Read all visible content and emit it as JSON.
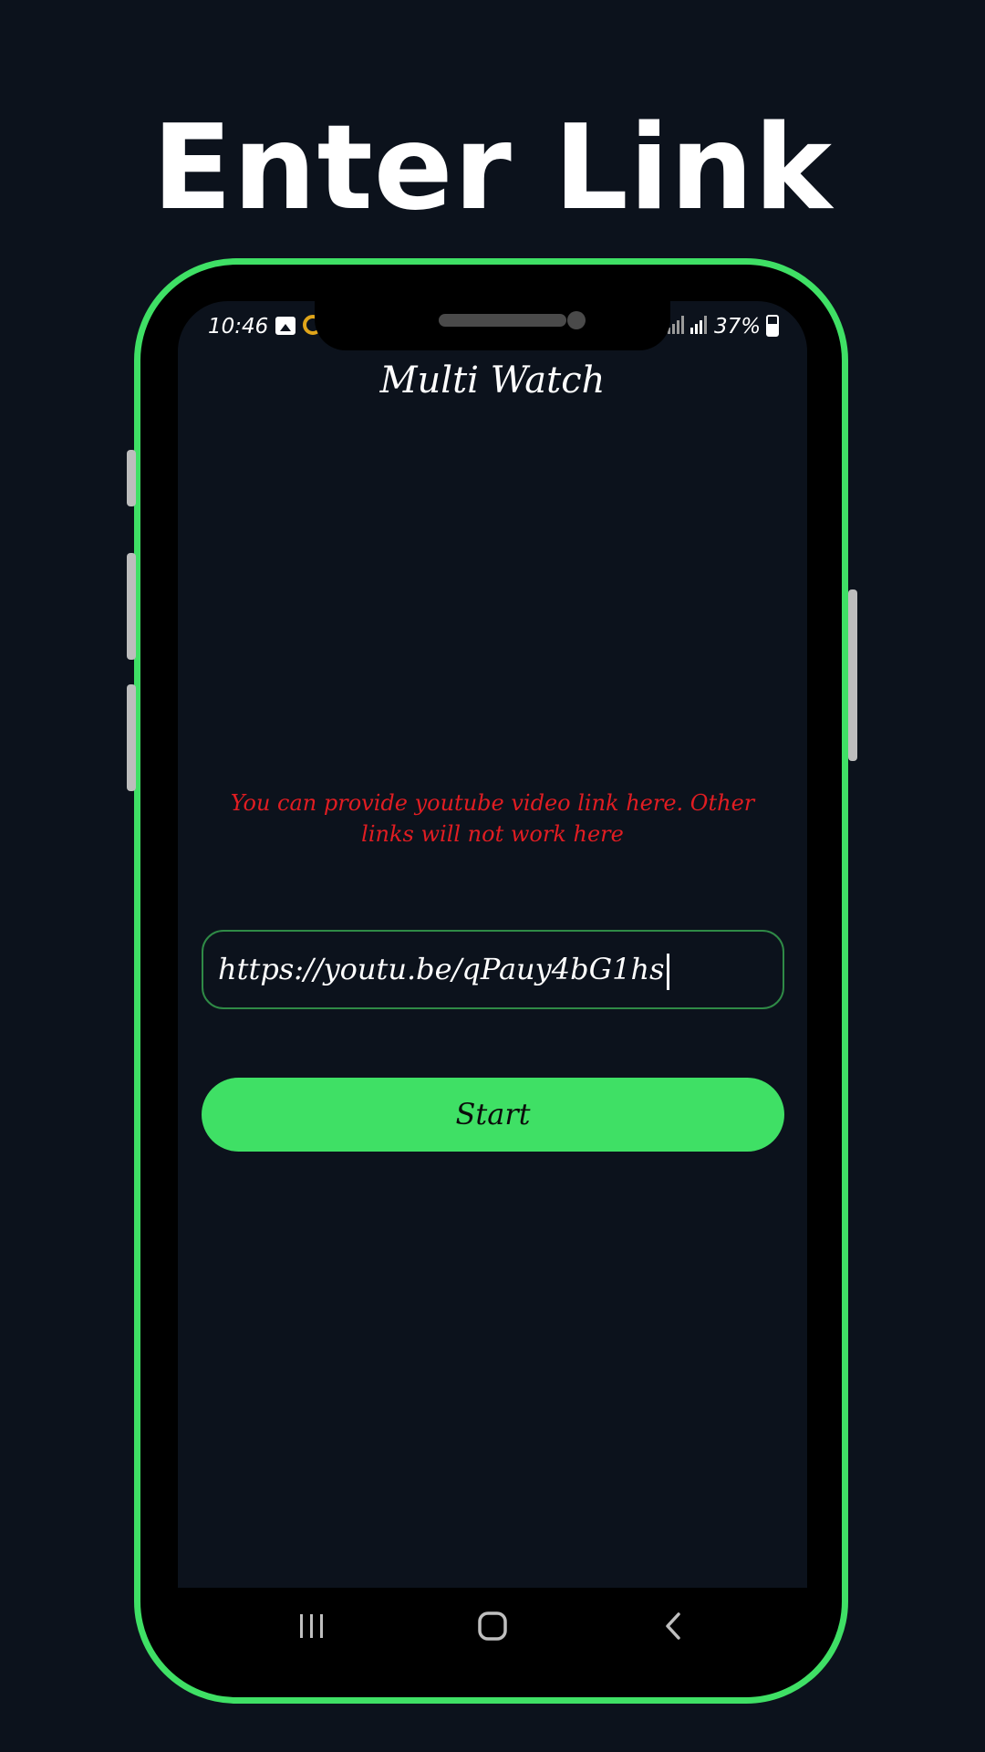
{
  "headline": "Enter Link",
  "status_bar": {
    "time": "10:46",
    "battery": "37%"
  },
  "app": {
    "title": "Multi Watch",
    "hint": "You can provide youtube video link here. Other links will not work here",
    "link_input": {
      "value": "https://youtu.be/qPauy4bG1hs"
    },
    "start_label": "Start"
  },
  "colors": {
    "background": "#0c121c",
    "accent_green": "#3fe065",
    "hint_red": "#e11d22",
    "input_border": "#2f8a46"
  },
  "icons": {
    "status": [
      "gallery-icon",
      "google-icon",
      "signal-icon",
      "signal-icon",
      "battery-charging-icon"
    ],
    "nav": [
      "recent-apps-icon",
      "home-icon",
      "back-icon"
    ]
  }
}
